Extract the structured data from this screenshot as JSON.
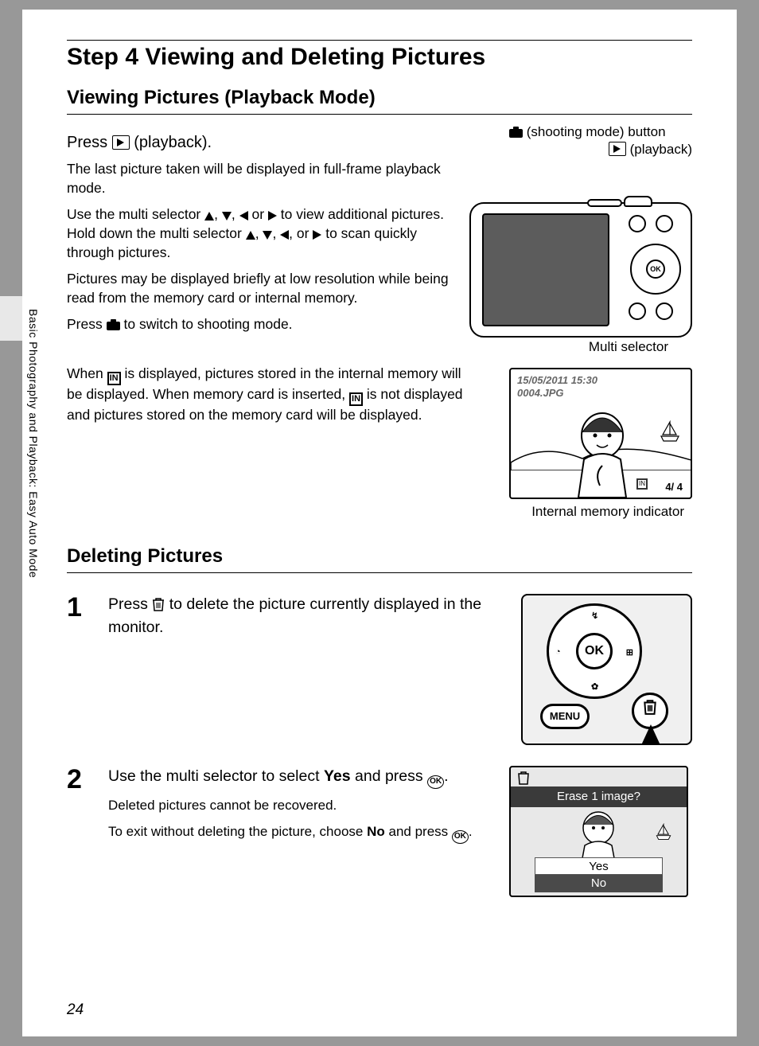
{
  "page_number": "24",
  "side_tab_text": "Basic Photography and Playback: Easy Auto Mode",
  "h1": "Step 4 Viewing and Deleting Pictures",
  "h2_viewing": "Viewing Pictures (Playback Mode)",
  "h3_press": "Press",
  "h3_press_suffix": "(playback).",
  "p1": "The last picture taken will be displayed in full-frame playback mode.",
  "p2_a": "Use the multi selector ",
  "p2_b": " to view additional pictures. Hold down the multi selector ",
  "p2_c": " to scan quickly through pictures.",
  "p3": "Pictures may be displayed briefly at low resolution while being read from the memory card or internal memory.",
  "p4_a": "Press ",
  "p4_b": " to switch to shooting mode.",
  "p5_a": "When ",
  "p5_b": " is displayed, pictures stored in the internal memory will be displayed. When memory card is inserted, ",
  "p5_c": " is not displayed and pictures stored on the memory card will be displayed.",
  "fig1": {
    "shooting_label": "(shooting mode) button",
    "playback_label": "(playback)",
    "multi_label": "Multi selector",
    "ok": "OK"
  },
  "playback": {
    "date": "15/05/2011 15:30",
    "file": "0004.JPG",
    "count": "4/    4",
    "ind_label": "Internal memory indicator"
  },
  "h2_deleting": "Deleting Pictures",
  "step1": {
    "num": "1",
    "text_a": "Press ",
    "text_b": " to delete the picture currently displayed in the monitor.",
    "menu": "MENU",
    "ok": "OK",
    "dpad_up": "↯",
    "dpad_down": "✿",
    "dpad_left": "◔",
    "dpad_right": "⊞"
  },
  "step2": {
    "num": "2",
    "lead_a": "Use the multi selector to select ",
    "lead_yes": "Yes",
    "lead_b": " and press ",
    "p1": "Deleted pictures cannot be recovered.",
    "p2_a": "To exit without deleting the picture, choose ",
    "p2_no": "No",
    "p2_b": " and press ",
    "dialog_title": "Erase 1 image?",
    "opt_yes": "Yes",
    "opt_no": "No"
  },
  "ok_label": "OK",
  "in_label": "IN",
  "sep_comma": ", ",
  "sep_or": " or "
}
